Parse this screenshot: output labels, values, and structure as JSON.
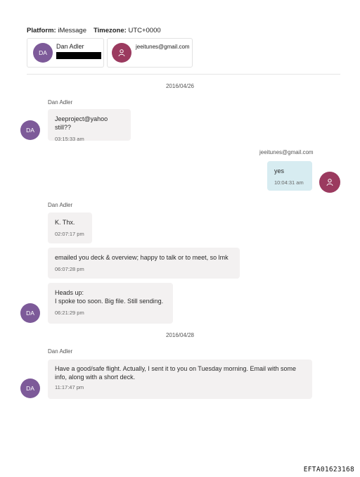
{
  "header": {
    "platform_label": "Platform:",
    "platform_value": "iMessage",
    "timezone_label": "Timezone:",
    "timezone_value": "UTC+0000"
  },
  "participants": [
    {
      "initials": "DA",
      "name": "Dan Adler",
      "redacted": true
    },
    {
      "icon": "user-icon",
      "name": "jeeitunes@gmail.com"
    }
  ],
  "conversation": {
    "date1": "2016/04/26",
    "sender_dan": "Dan Adler",
    "sender_me": "jeeitunes@gmail.com",
    "messages": [
      {
        "text": "Jeeproject@yahoo still??",
        "time": "03:15:33 am"
      },
      {
        "text": "yes",
        "time": "10:04:31 am"
      },
      {
        "text": "K. Thx.",
        "time": "02:07:17 pm"
      },
      {
        "text": "emailed you deck & overview; happy to talk or to meet, so lmk",
        "time": "06:07:28 pm"
      },
      {
        "text_line1": "Heads up:",
        "text_line2": "I spoke too soon. Big file. Still sending.",
        "time": "06:21:29 pm"
      },
      {
        "text": "Have a good/safe flight. Actually, I sent it to you on Tuesday morning.  Email with some info, along with a short deck.",
        "time": "11:17:47 pm"
      }
    ],
    "date2": "2016/04/28"
  },
  "avatar_initials": "DA",
  "footer_id": "EFTA01623168",
  "colors": {
    "avatar_da": "#7d5a99",
    "avatar_user": "#9b3a5f",
    "incoming_bubble": "#f3f1f1",
    "outgoing_bubble": "#d7ecf1"
  }
}
